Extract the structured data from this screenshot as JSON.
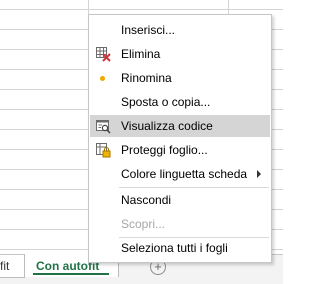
{
  "sheet_tabs": {
    "previous_tab_label": "fit",
    "active_tab_label": "Con autofit",
    "add_sheet_symbol": "+"
  },
  "context_menu": {
    "items": [
      {
        "label": "Inserisci...",
        "enabled": true
      },
      {
        "label": "Elimina",
        "enabled": true,
        "icon": "delete-sheet-icon"
      },
      {
        "label": "Rinomina",
        "enabled": true,
        "icon": "rename-dot-icon"
      },
      {
        "label": "Sposta o copia...",
        "enabled": true
      },
      {
        "label": "Visualizza codice",
        "enabled": true,
        "icon": "view-code-icon",
        "highlighted": true
      },
      {
        "label": "Proteggi foglio...",
        "enabled": true,
        "icon": "protect-sheet-icon"
      },
      {
        "label": "Colore linguetta scheda",
        "enabled": true,
        "submenu": true
      },
      {
        "label": "Nascondi",
        "enabled": true
      },
      {
        "label": "Scopri...",
        "enabled": false
      },
      {
        "label": "Seleziona tutti i fogli",
        "enabled": true
      }
    ]
  },
  "colors": {
    "accent_green": "#217346",
    "menu_hover": "#d5d5d5",
    "disabled_text": "#a6a6a6",
    "delete_icon_red": "#d13438",
    "rename_dot": "#f0a800"
  }
}
